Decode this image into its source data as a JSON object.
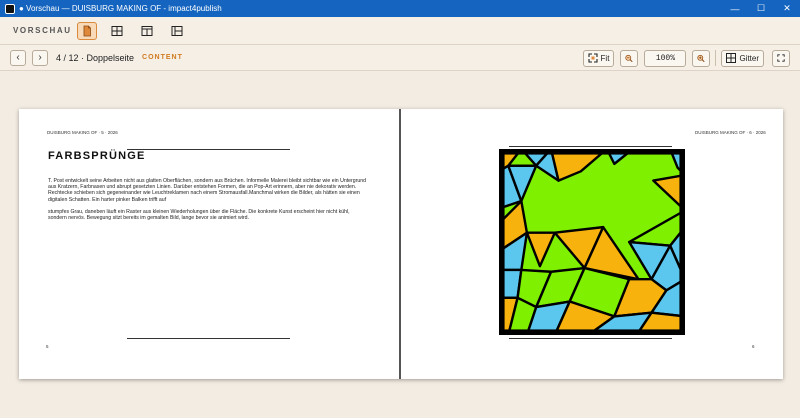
{
  "window": {
    "title": "● Vorschau — DUISBURG MAKING OF - impact4publish",
    "controls": {
      "minimize": "—",
      "maximize": "☐",
      "close": "✕"
    }
  },
  "toolbar": {
    "brand": "VORSCHAU",
    "view_buttons": [
      "single-page-view",
      "grid-view",
      "spread-view",
      "list-view"
    ],
    "active_view": "single-page-view"
  },
  "navigation": {
    "prev": "‹",
    "next": "›",
    "page_info": "4 / 12 · Doppelseite",
    "section": "CONTENT"
  },
  "zoom": {
    "fit_label": "Fit",
    "value": "100%",
    "grid_label": "Gitter",
    "fullscreen_icon": "fullscreen-icon"
  },
  "spread": {
    "left": {
      "running_head": "DUISBURG MAKING OF · 5 · 2026",
      "heading": "FARBSPRÜNGE",
      "paragraph1": "T. Post entwickelt seine Arbeiten nicht aus glatten Oberflächen, sondern aus Brüchen. Informelle Malerei bleibt sichtbar wie ein Untergrund aus Kratzern, Farbnasen und abrupt gesetzten Linien. Darüber entstehen Formen, die an Pop-Art erinnern, aber nie dekorativ werden. Rechtecke schieben sich gegeneinander wie Leuchtreklamen nach einem Stromausfall.Manchmal wirken die Bilder, als hätten sie einen digitalen Schatten. Ein harter pinker Balken trifft auf",
      "paragraph2": "stumpfes Grau, daneben läuft ein Raster aus kleinen Wiederholungen über die Fläche. Die konkrete Kunst erscheint hier nicht kühl, sondern nervös. Bewegung sitzt bereits im gemalten Bild, lange bevor sie animiert wird.",
      "folio": "5"
    },
    "right": {
      "running_head": "DUISBURG MAKING OF · 6 · 2026",
      "folio": "6"
    }
  },
  "colors": {
    "titlebar": "#1565c0",
    "accent": "#d17a1e",
    "art_green": "#7ff000",
    "art_orange": "#f8b20e",
    "art_blue": "#5cc7ee"
  }
}
